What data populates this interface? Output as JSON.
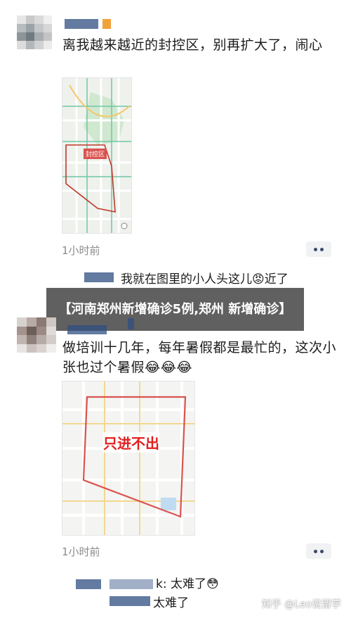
{
  "post1": {
    "text": "离我越来越近的封控区，别再扩大了，闹心",
    "map_label": "封控区",
    "time": "1小时前"
  },
  "post1_comment": {
    "text": "我就在图里的小人头这儿",
    "emoji": "😡",
    "tail": "近了"
  },
  "banner": {
    "text": "【河南郑州新增确诊5例,郑州 新增确诊】"
  },
  "post2": {
    "text": "做培训十几年，每年暑假都是最忙的，这次小张也过个暑假",
    "emojis": "😂😂😂",
    "map_label": "只进不出",
    "time": "1小时前"
  },
  "post2_comments": [
    {
      "suffix": "k: 太难了",
      "emoji": "😳"
    },
    {
      "suffix": "太难了"
    }
  ],
  "watermark": "知乎 @Leo说留学",
  "colors": {
    "map_border": "#d9534f",
    "mask_blue": "#2f4d82",
    "mask_orange": "#f2a23a"
  },
  "icons": [
    "avatar-mosaic",
    "more-dots-icon",
    "angry-emoji-icon",
    "laugh-cry-emoji-icon",
    "flushed-emoji-icon"
  ]
}
